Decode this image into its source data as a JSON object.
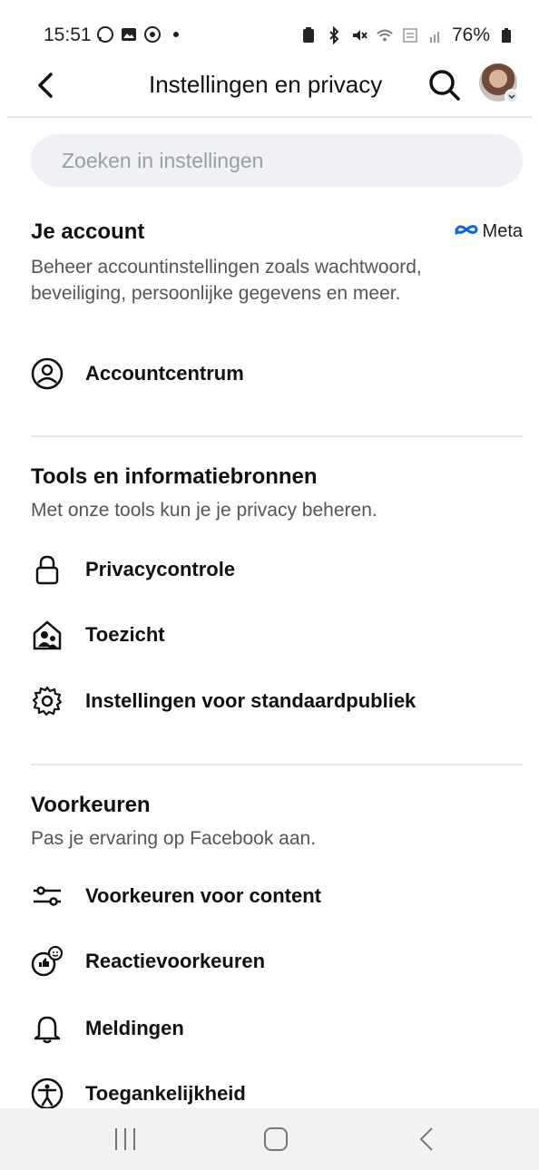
{
  "status": {
    "time": "15:51",
    "battery": "76%"
  },
  "header": {
    "title": "Instellingen en privacy"
  },
  "search": {
    "placeholder": "Zoeken in instellingen"
  },
  "sections": [
    {
      "title": "Je account",
      "badge": "Meta",
      "desc": "Beheer accountinstellingen zoals wachtwoord, beveiliging, persoonlijke gegevens en meer.",
      "items": [
        {
          "label": "Accountcentrum",
          "icon": "person-circle-icon"
        }
      ]
    },
    {
      "title": "Tools en informatiebronnen",
      "desc": "Met onze tools kun je je privacy beheren.",
      "items": [
        {
          "label": "Privacycontrole",
          "icon": "lock-icon"
        },
        {
          "label": "Toezicht",
          "icon": "supervision-icon"
        },
        {
          "label": "Instellingen voor standaardpubliek",
          "icon": "gear-icon"
        }
      ]
    },
    {
      "title": "Voorkeuren",
      "desc": "Pas je ervaring op Facebook aan.",
      "items": [
        {
          "label": "Voorkeuren voor content",
          "icon": "sliders-icon"
        },
        {
          "label": "Reactievoorkeuren",
          "icon": "reaction-icon"
        },
        {
          "label": "Meldingen",
          "icon": "bell-icon"
        },
        {
          "label": "Toegankelijkheid",
          "icon": "accessibility-icon"
        }
      ]
    }
  ],
  "colors": {
    "accent": "#0668E1",
    "text": "#1c1e21",
    "muted": "#555555",
    "searchbg": "#eff1f4"
  }
}
